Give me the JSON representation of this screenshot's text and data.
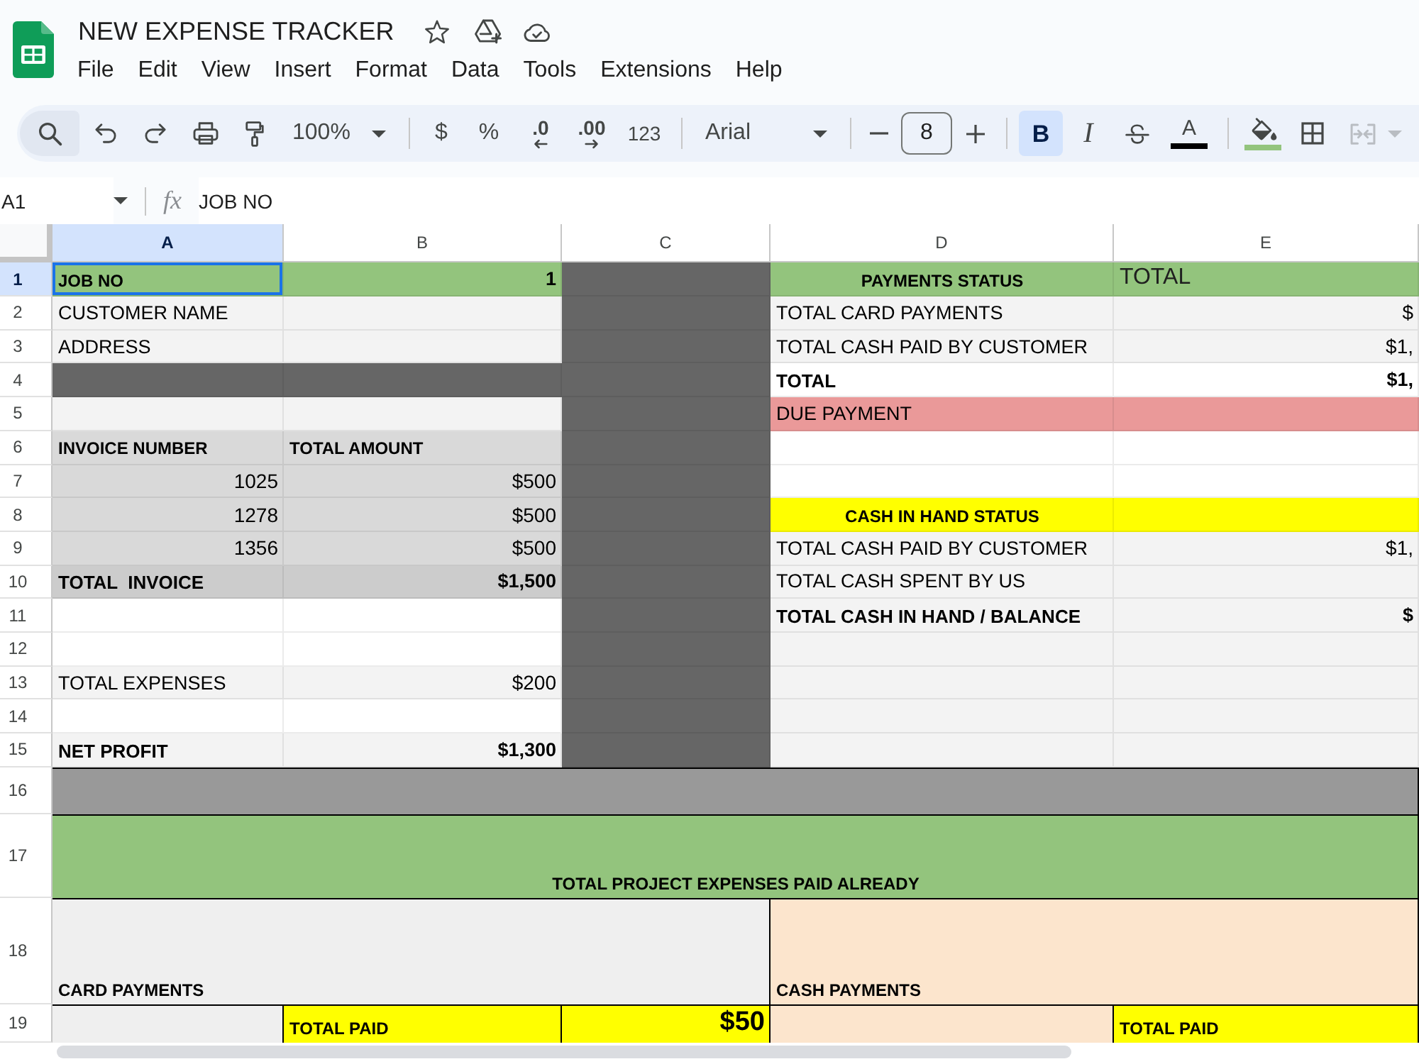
{
  "app": {
    "title": "NEW EXPENSE TRACKER"
  },
  "menu": [
    "File",
    "Edit",
    "View",
    "Insert",
    "Format",
    "Data",
    "Tools",
    "Extensions",
    "Help"
  ],
  "toolbar": {
    "zoom": "100%",
    "currency": "$",
    "percent": "%",
    "decrease_decimal": ".0",
    "increase_decimal": ".00",
    "number_format": "123",
    "font": "Arial",
    "font_size": "8",
    "bold": {
      "label": "B",
      "on": true
    },
    "italic": {
      "label": "I",
      "on": false
    },
    "strikethrough": {
      "on": false
    },
    "text_color": {
      "label": "A",
      "color": "#000000"
    },
    "fill_color": {
      "color": "#93c47d"
    },
    "merge": {
      "disabled": true
    }
  },
  "formula_bar": {
    "cell": "A1",
    "label": "fx",
    "formula": "JOB NO"
  },
  "columns": [
    {
      "label": "A",
      "selected": true
    },
    {
      "label": "B",
      "selected": false
    },
    {
      "label": "C",
      "selected": false
    },
    {
      "label": "D",
      "selected": false
    },
    {
      "label": "E",
      "selected": false
    }
  ],
  "rows": [
    {
      "label": "1",
      "selected": true,
      "kind": "normal",
      "cells": [
        {
          "text": "JOB NO",
          "kind": "heading",
          "color": "#93c47d"
        },
        {
          "text": "1",
          "kind": "total_amount",
          "color": "#93c47d"
        },
        {
          "color": "#666666"
        },
        {
          "text": "PAYMENTS STATUS",
          "kind": "title",
          "color": "#93c47d"
        },
        {
          "text": "TOTAL",
          "kind": "caption",
          "color": "#93c47d"
        }
      ]
    },
    {
      "label": "2",
      "selected": false,
      "kind": "normal",
      "cells": [
        {
          "text": "CUSTOMER NAME",
          "kind": "label",
          "color": "#f3f3f3"
        },
        {
          "color": "#f3f3f3"
        },
        {
          "color": "#666666"
        },
        {
          "text": "TOTAL CARD PAYMENTS",
          "kind": "label",
          "color": "#f3f3f3"
        },
        {
          "text": "$",
          "kind": "amount",
          "color": "#f3f3f3"
        }
      ]
    },
    {
      "label": "3",
      "selected": false,
      "kind": "normal",
      "cells": [
        {
          "text": "ADDRESS",
          "kind": "label",
          "color": "#f3f3f3"
        },
        {
          "color": "#f3f3f3"
        },
        {
          "color": "#666666"
        },
        {
          "text": "TOTAL CASH PAID BY CUSTOMER",
          "kind": "label",
          "color": "#f3f3f3"
        },
        {
          "text": "$1,",
          "kind": "amount",
          "color": "#f3f3f3"
        }
      ]
    },
    {
      "label": "4",
      "selected": false,
      "kind": "normal",
      "cells": [
        {
          "color": "#666666"
        },
        {
          "color": "#666666"
        },
        {
          "color": "#666666"
        },
        {
          "text": "TOTAL",
          "kind": "total_label",
          "color": "#ffffff"
        },
        {
          "text": "$1,",
          "kind": "total_amount",
          "color": "#ffffff"
        }
      ]
    },
    {
      "label": "5",
      "selected": false,
      "kind": "normal",
      "cells": [
        {
          "color": "#f3f3f3"
        },
        {
          "color": "#f3f3f3"
        },
        {
          "color": "#666666"
        },
        {
          "text": "DUE PAYMENT",
          "kind": "label",
          "color": "#ea9999"
        },
        {
          "color": "#ea9999"
        }
      ]
    },
    {
      "label": "6",
      "selected": false,
      "kind": "normal",
      "cells": [
        {
          "text": "INVOICE NUMBER",
          "kind": "heading",
          "color": "#d9d9d9"
        },
        {
          "text": "TOTAL AMOUNT",
          "kind": "heading",
          "color": "#d9d9d9"
        },
        {
          "color": "#666666"
        },
        {
          "color": "#ffffff"
        },
        {
          "color": "#ffffff"
        }
      ]
    },
    {
      "label": "7",
      "selected": false,
      "kind": "normal",
      "cells": [
        {
          "text": "1025",
          "kind": "amount",
          "color": "#d9d9d9"
        },
        {
          "text": "$500",
          "kind": "amount",
          "color": "#d9d9d9"
        },
        {
          "color": "#666666"
        },
        {
          "color": "#ffffff"
        },
        {
          "color": "#ffffff"
        }
      ]
    },
    {
      "label": "8",
      "selected": false,
      "kind": "normal",
      "cells": [
        {
          "text": "1278",
          "kind": "amount",
          "color": "#d9d9d9"
        },
        {
          "text": "$500",
          "kind": "amount",
          "color": "#d9d9d9"
        },
        {
          "color": "#666666"
        },
        {
          "text": "CASH IN HAND STATUS",
          "kind": "title",
          "color": "#ffff00"
        },
        {
          "color": "#ffff00"
        }
      ]
    },
    {
      "label": "9",
      "selected": false,
      "kind": "normal",
      "cells": [
        {
          "text": "1356",
          "kind": "amount",
          "color": "#d9d9d9"
        },
        {
          "text": "$500",
          "kind": "amount",
          "color": "#d9d9d9"
        },
        {
          "color": "#666666"
        },
        {
          "text": "TOTAL CASH PAID BY CUSTOMER",
          "kind": "label",
          "color": "#f3f3f3"
        },
        {
          "text": "$1,",
          "kind": "amount",
          "color": "#f3f3f3"
        }
      ]
    },
    {
      "label": "10",
      "selected": false,
      "kind": "normal",
      "cells": [
        {
          "text": "TOTAL  INVOICE",
          "kind": "total_label",
          "color": "#cccccc"
        },
        {
          "text": "$1,500",
          "kind": "total_amount",
          "color": "#cccccc"
        },
        {
          "color": "#666666"
        },
        {
          "text": "TOTAL CASH SPENT BY US",
          "kind": "label",
          "color": "#f3f3f3"
        },
        {
          "color": "#f3f3f3"
        }
      ]
    },
    {
      "label": "11",
      "selected": false,
      "kind": "normal",
      "cells": [
        {
          "color": "#ffffff"
        },
        {
          "color": "#ffffff"
        },
        {
          "color": "#666666"
        },
        {
          "text": "TOTAL CASH IN HAND / BALANCE",
          "kind": "total_label",
          "color": "#f3f3f3"
        },
        {
          "text": "$",
          "kind": "total_amount",
          "color": "#f3f3f3"
        }
      ]
    },
    {
      "label": "12",
      "selected": false,
      "kind": "normal",
      "cells": [
        {
          "color": "#ffffff"
        },
        {
          "color": "#ffffff"
        },
        {
          "color": "#666666"
        },
        {
          "color": "#f3f3f3"
        },
        {
          "color": "#f3f3f3"
        }
      ]
    },
    {
      "label": "13",
      "selected": false,
      "kind": "normal",
      "cells": [
        {
          "text": "TOTAL EXPENSES",
          "kind": "label",
          "color": "#f3f3f3"
        },
        {
          "text": "$200",
          "kind": "amount",
          "color": "#f3f3f3"
        },
        {
          "color": "#666666"
        },
        {
          "color": "#f3f3f3"
        },
        {
          "color": "#f3f3f3"
        }
      ]
    },
    {
      "label": "14",
      "selected": false,
      "kind": "normal",
      "cells": [
        {
          "color": "#ffffff"
        },
        {
          "color": "#ffffff"
        },
        {
          "color": "#666666"
        },
        {
          "color": "#f3f3f3"
        },
        {
          "color": "#f3f3f3"
        }
      ]
    },
    {
      "label": "15",
      "selected": false,
      "kind": "normal",
      "cells": [
        {
          "text": "NET PROFIT",
          "kind": "total_label",
          "color": "#f3f3f3"
        },
        {
          "text": "$1,300",
          "kind": "total_amount",
          "color": "#f3f3f3"
        },
        {
          "color": "#666666"
        },
        {
          "color": "#f3f3f3"
        },
        {
          "color": "#f3f3f3"
        }
      ]
    },
    {
      "label": "16",
      "selected": false,
      "kind": "band",
      "cells": [
        {
          "color": "#999999"
        }
      ]
    },
    {
      "label": "17",
      "selected": false,
      "kind": "band",
      "cells": [
        {
          "text": "TOTAL PROJECT EXPENSES PAID ALREADY",
          "kind": "title",
          "color": "#93c47d"
        }
      ]
    },
    {
      "label": "18",
      "selected": false,
      "kind": "band",
      "cells": [
        {
          "text": "CARD PAYMENTS",
          "kind": "heading",
          "color": "#efefef"
        },
        {
          "text": "CASH PAYMENTS",
          "kind": "heading",
          "color": "#fce5cd"
        }
      ]
    },
    {
      "label": "19",
      "selected": false,
      "kind": "band",
      "cells": [
        {
          "color": "#efefef"
        },
        {
          "text": "TOTAL PAID",
          "kind": "heading",
          "color": "#ffff00"
        },
        {
          "text": "$50",
          "kind": "big_amount",
          "color": "#ffff00"
        },
        {
          "color": "#fce5cd"
        },
        {
          "text": "TOTAL PAID",
          "kind": "heading",
          "color": "#ffff00"
        }
      ]
    }
  ]
}
